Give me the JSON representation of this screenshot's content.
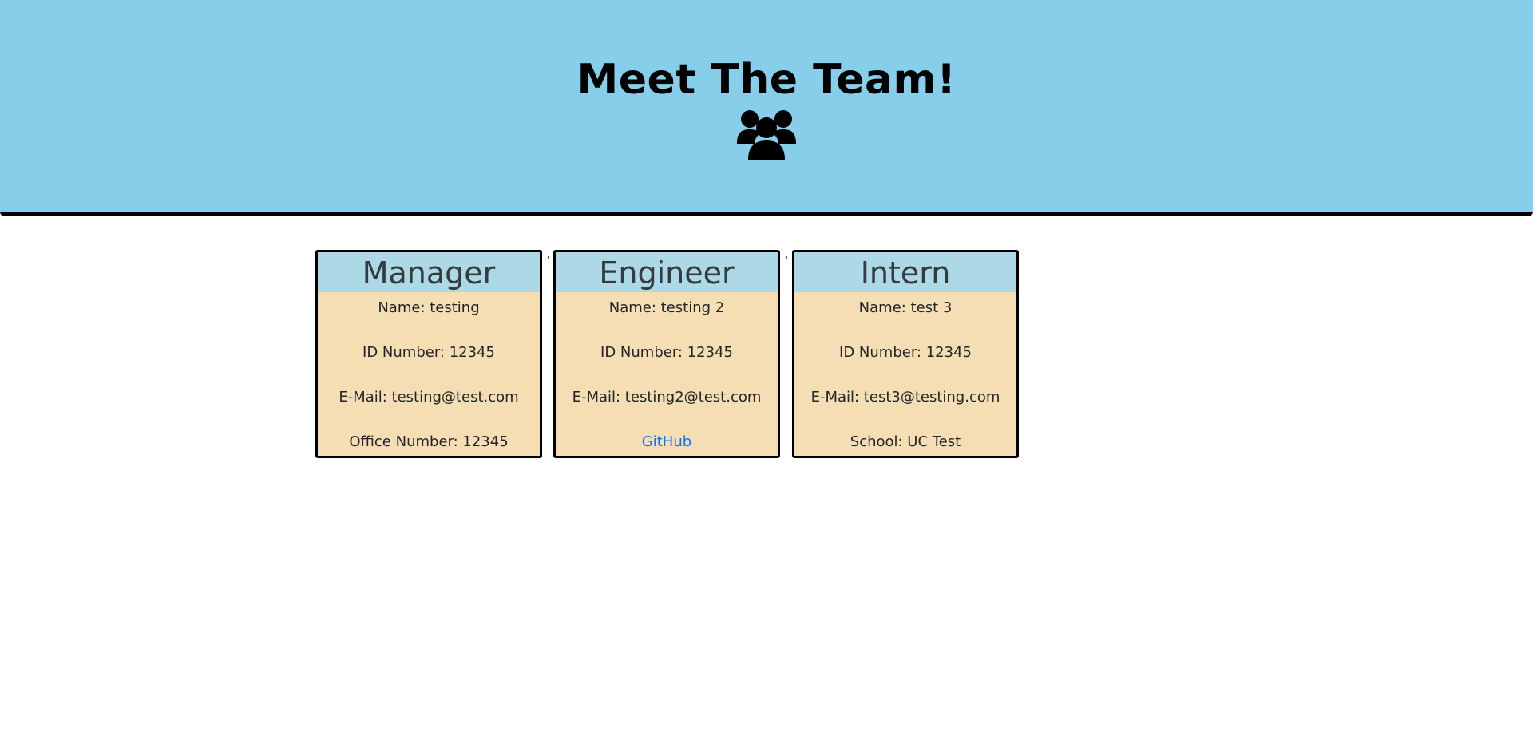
{
  "header": {
    "title": "Meet The Team!",
    "icon": "users-icon"
  },
  "cards": [
    {
      "role": "Manager",
      "lines": [
        "Name: testing",
        "ID Number: 12345",
        "E-Mail: testing@test.com",
        "Office Number: 12345"
      ]
    },
    {
      "role": "Engineer",
      "lines": [
        "Name: testing 2",
        "ID Number: 12345",
        "E-Mail: testing2@test.com"
      ],
      "link": "GitHub"
    },
    {
      "role": "Intern",
      "lines": [
        "Name: test 3",
        "ID Number: 12345",
        "E-Mail: test3@testing.com",
        "School: UC Test"
      ]
    }
  ],
  "colors": {
    "banner": "#87ceeb",
    "card_header": "#add8e6",
    "card_body": "#f5deb3",
    "link": "#0d6efd"
  }
}
